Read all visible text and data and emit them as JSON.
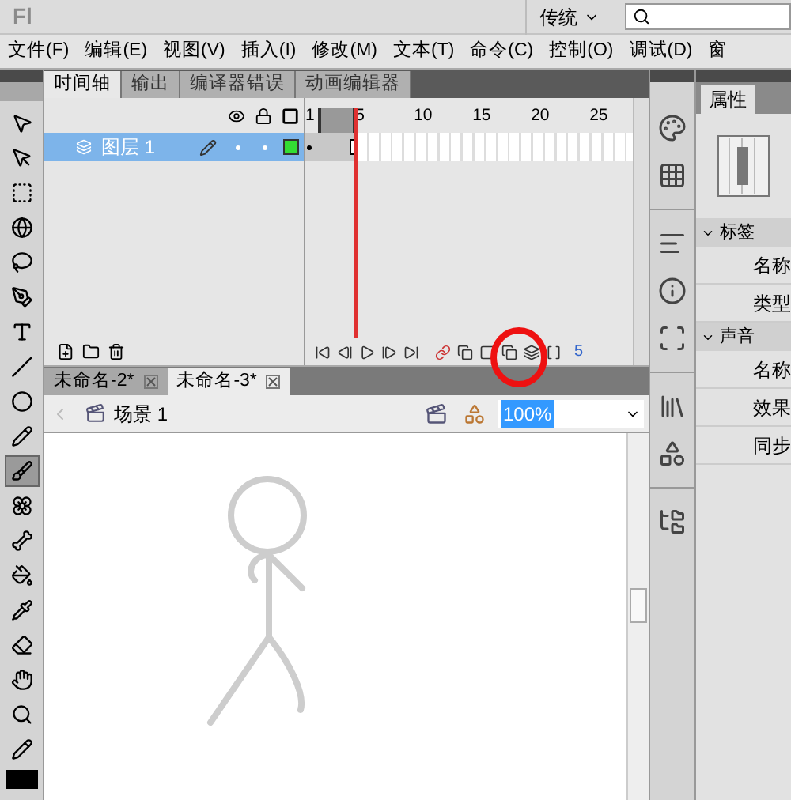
{
  "app": {
    "logo": "Fl",
    "workspace": "传统"
  },
  "menu": [
    "文件(F)",
    "编辑(E)",
    "视图(V)",
    "插入(I)",
    "修改(M)",
    "文本(T)",
    "命令(C)",
    "控制(O)",
    "调试(D)",
    "窗"
  ],
  "tools": [
    {
      "selected": false
    },
    {
      "selected": false
    },
    {
      "selected": false
    },
    {
      "selected": false
    },
    {
      "selected": false
    },
    {
      "selected": false
    },
    {
      "selected": false
    },
    {
      "selected": false
    },
    {
      "selected": false
    },
    {
      "selected": false
    },
    {
      "selected": true
    },
    {
      "selected": false
    },
    {
      "selected": false
    },
    {
      "selected": false
    },
    {
      "selected": false
    },
    {
      "selected": false
    },
    {
      "selected": false
    },
    {
      "selected": false
    },
    {
      "selected": false
    }
  ],
  "timeline": {
    "tabs": [
      {
        "label": "时间轴",
        "selected": true
      },
      {
        "label": "输出",
        "selected": false
      },
      {
        "label": "编译器错误",
        "selected": false
      },
      {
        "label": "动画编辑器",
        "selected": false
      }
    ],
    "frame_numbers": [
      "1",
      "5",
      "10",
      "15",
      "20",
      "25"
    ],
    "layers": [
      {
        "name": "图层 1",
        "selected": true,
        "color": "#33dd33"
      }
    ],
    "current_frame": "5"
  },
  "documents": [
    {
      "label": "未命名-2*",
      "selected": false
    },
    {
      "label": "未命名-3*",
      "selected": true
    }
  ],
  "scene": {
    "label": "场景 1",
    "zoom": "100%"
  },
  "properties": {
    "tab": "属性",
    "sections": [
      {
        "title": "标签",
        "rows": [
          "名称",
          "类型"
        ]
      },
      {
        "title": "声音",
        "rows": [
          "名称",
          "效果",
          "同步"
        ]
      }
    ]
  }
}
